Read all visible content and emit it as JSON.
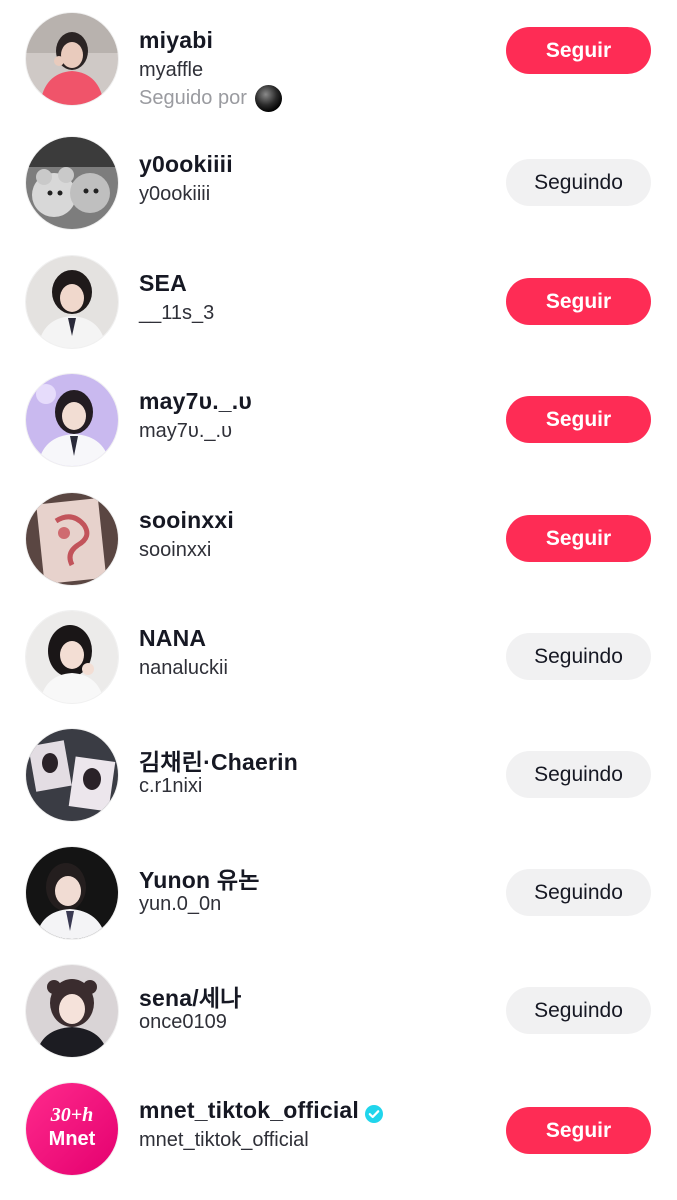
{
  "colors": {
    "follow_button": "#fe2c55",
    "following_button": "#f1f1f2",
    "secondary_text": "#9a9ba0",
    "verified_badge": "#20d5ec"
  },
  "users": [
    {
      "name": "miyabi",
      "handle": "myaffle",
      "followed_by": "Seguido por",
      "button": "Seguir",
      "following": false
    },
    {
      "name": "y0ookiiii",
      "handle": "y0ookiiii",
      "button": "Seguindo",
      "following": true
    },
    {
      "name": "SEA",
      "handle": "__11s_3",
      "button": "Seguir",
      "following": false
    },
    {
      "name": "may7υ._.υ",
      "handle": "may7υ._.υ",
      "button": "Seguir",
      "following": false
    },
    {
      "name": "sooinxxi",
      "handle": "sooinxxi",
      "button": "Seguir",
      "following": false
    },
    {
      "name": "NANA",
      "handle": "nanaluckii",
      "button": "Seguindo",
      "following": true
    },
    {
      "name": "김채린·Chaerin",
      "handle": "c.r1nixi",
      "button": "Seguindo",
      "following": true
    },
    {
      "name": "Yunon 유논",
      "handle": "yun.0_0n",
      "button": "Seguindo",
      "following": true
    },
    {
      "name": "sena/세나",
      "handle": "once0109",
      "button": "Seguindo",
      "following": true
    },
    {
      "name": "mnet_tiktok_official",
      "handle": "mnet_tiktok_official",
      "button": "Seguir",
      "following": false,
      "verified": true,
      "avatar_text": [
        "30+h",
        "Mnet"
      ]
    }
  ]
}
